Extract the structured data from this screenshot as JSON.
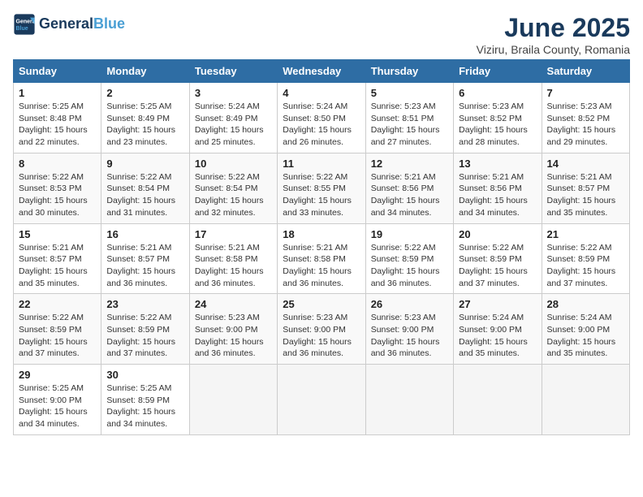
{
  "logo": {
    "line1": "General",
    "line2": "Blue"
  },
  "title": "June 2025",
  "location": "Viziru, Braila County, Romania",
  "weekdays": [
    "Sunday",
    "Monday",
    "Tuesday",
    "Wednesday",
    "Thursday",
    "Friday",
    "Saturday"
  ],
  "weeks": [
    [
      {
        "day": "1",
        "info": "Sunrise: 5:25 AM\nSunset: 8:48 PM\nDaylight: 15 hours\nand 22 minutes."
      },
      {
        "day": "2",
        "info": "Sunrise: 5:25 AM\nSunset: 8:49 PM\nDaylight: 15 hours\nand 23 minutes."
      },
      {
        "day": "3",
        "info": "Sunrise: 5:24 AM\nSunset: 8:49 PM\nDaylight: 15 hours\nand 25 minutes."
      },
      {
        "day": "4",
        "info": "Sunrise: 5:24 AM\nSunset: 8:50 PM\nDaylight: 15 hours\nand 26 minutes."
      },
      {
        "day": "5",
        "info": "Sunrise: 5:23 AM\nSunset: 8:51 PM\nDaylight: 15 hours\nand 27 minutes."
      },
      {
        "day": "6",
        "info": "Sunrise: 5:23 AM\nSunset: 8:52 PM\nDaylight: 15 hours\nand 28 minutes."
      },
      {
        "day": "7",
        "info": "Sunrise: 5:23 AM\nSunset: 8:52 PM\nDaylight: 15 hours\nand 29 minutes."
      }
    ],
    [
      {
        "day": "8",
        "info": "Sunrise: 5:22 AM\nSunset: 8:53 PM\nDaylight: 15 hours\nand 30 minutes."
      },
      {
        "day": "9",
        "info": "Sunrise: 5:22 AM\nSunset: 8:54 PM\nDaylight: 15 hours\nand 31 minutes."
      },
      {
        "day": "10",
        "info": "Sunrise: 5:22 AM\nSunset: 8:54 PM\nDaylight: 15 hours\nand 32 minutes."
      },
      {
        "day": "11",
        "info": "Sunrise: 5:22 AM\nSunset: 8:55 PM\nDaylight: 15 hours\nand 33 minutes."
      },
      {
        "day": "12",
        "info": "Sunrise: 5:21 AM\nSunset: 8:56 PM\nDaylight: 15 hours\nand 34 minutes."
      },
      {
        "day": "13",
        "info": "Sunrise: 5:21 AM\nSunset: 8:56 PM\nDaylight: 15 hours\nand 34 minutes."
      },
      {
        "day": "14",
        "info": "Sunrise: 5:21 AM\nSunset: 8:57 PM\nDaylight: 15 hours\nand 35 minutes."
      }
    ],
    [
      {
        "day": "15",
        "info": "Sunrise: 5:21 AM\nSunset: 8:57 PM\nDaylight: 15 hours\nand 35 minutes."
      },
      {
        "day": "16",
        "info": "Sunrise: 5:21 AM\nSunset: 8:57 PM\nDaylight: 15 hours\nand 36 minutes."
      },
      {
        "day": "17",
        "info": "Sunrise: 5:21 AM\nSunset: 8:58 PM\nDaylight: 15 hours\nand 36 minutes."
      },
      {
        "day": "18",
        "info": "Sunrise: 5:21 AM\nSunset: 8:58 PM\nDaylight: 15 hours\nand 36 minutes."
      },
      {
        "day": "19",
        "info": "Sunrise: 5:22 AM\nSunset: 8:59 PM\nDaylight: 15 hours\nand 36 minutes."
      },
      {
        "day": "20",
        "info": "Sunrise: 5:22 AM\nSunset: 8:59 PM\nDaylight: 15 hours\nand 37 minutes."
      },
      {
        "day": "21",
        "info": "Sunrise: 5:22 AM\nSunset: 8:59 PM\nDaylight: 15 hours\nand 37 minutes."
      }
    ],
    [
      {
        "day": "22",
        "info": "Sunrise: 5:22 AM\nSunset: 8:59 PM\nDaylight: 15 hours\nand 37 minutes."
      },
      {
        "day": "23",
        "info": "Sunrise: 5:22 AM\nSunset: 8:59 PM\nDaylight: 15 hours\nand 37 minutes."
      },
      {
        "day": "24",
        "info": "Sunrise: 5:23 AM\nSunset: 9:00 PM\nDaylight: 15 hours\nand 36 minutes."
      },
      {
        "day": "25",
        "info": "Sunrise: 5:23 AM\nSunset: 9:00 PM\nDaylight: 15 hours\nand 36 minutes."
      },
      {
        "day": "26",
        "info": "Sunrise: 5:23 AM\nSunset: 9:00 PM\nDaylight: 15 hours\nand 36 minutes."
      },
      {
        "day": "27",
        "info": "Sunrise: 5:24 AM\nSunset: 9:00 PM\nDaylight: 15 hours\nand 35 minutes."
      },
      {
        "day": "28",
        "info": "Sunrise: 5:24 AM\nSunset: 9:00 PM\nDaylight: 15 hours\nand 35 minutes."
      }
    ],
    [
      {
        "day": "29",
        "info": "Sunrise: 5:25 AM\nSunset: 9:00 PM\nDaylight: 15 hours\nand 34 minutes."
      },
      {
        "day": "30",
        "info": "Sunrise: 5:25 AM\nSunset: 8:59 PM\nDaylight: 15 hours\nand 34 minutes."
      },
      null,
      null,
      null,
      null,
      null
    ]
  ]
}
